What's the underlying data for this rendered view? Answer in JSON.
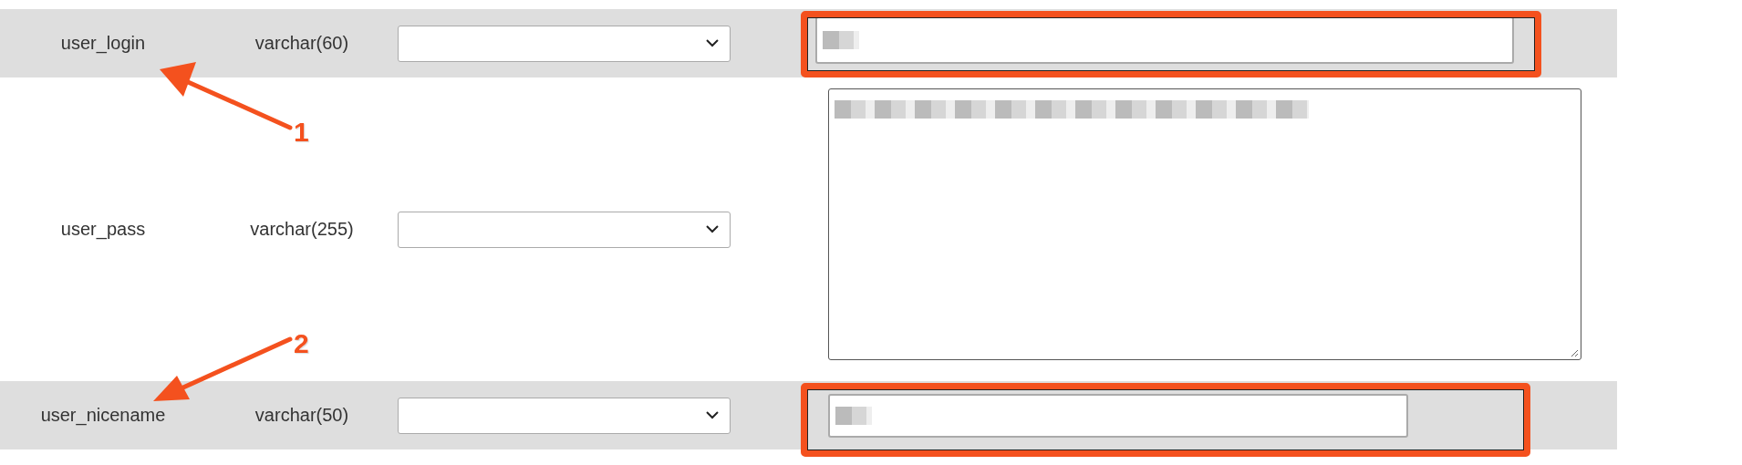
{
  "rows": [
    {
      "column": "user_login",
      "type": "varchar(60)",
      "kind": "text",
      "value_redacted": true,
      "highlighted": true,
      "shaded": true
    },
    {
      "column": "user_pass",
      "type": "varchar(255)",
      "kind": "textarea",
      "value_redacted": true,
      "highlighted": false,
      "shaded": false
    },
    {
      "column": "user_nicename",
      "type": "varchar(50)",
      "kind": "text",
      "value_redacted": true,
      "highlighted": true,
      "shaded": true
    }
  ],
  "annotations": [
    {
      "kind": "arrow",
      "label": "1"
    },
    {
      "kind": "arrow",
      "label": "2"
    }
  ]
}
